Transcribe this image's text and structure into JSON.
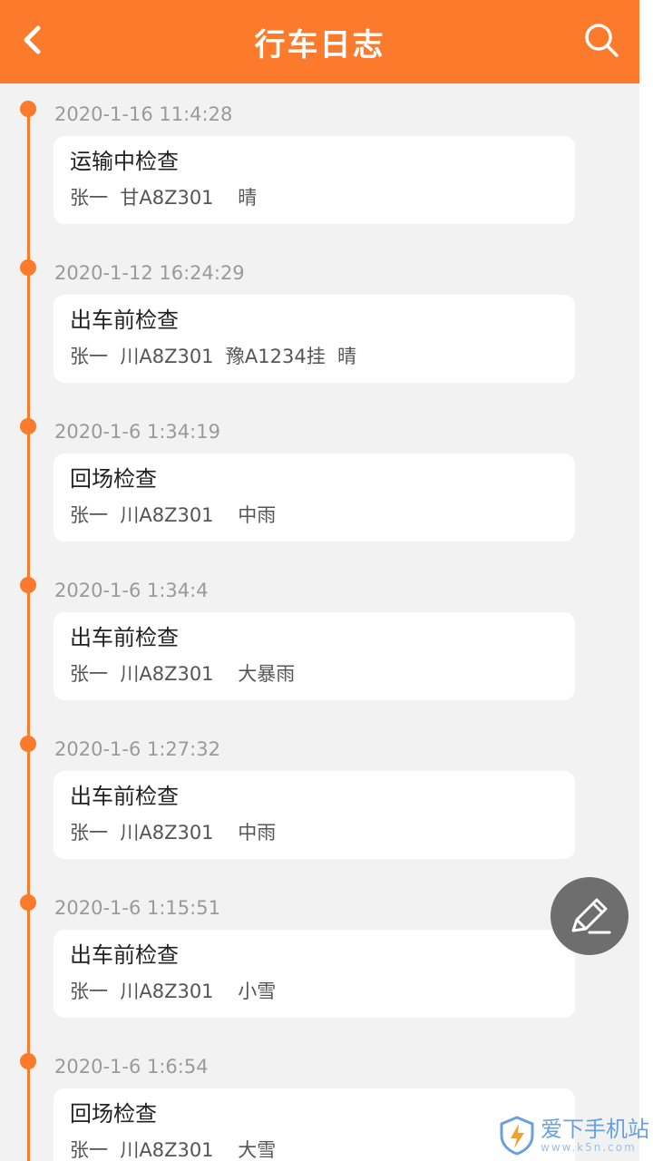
{
  "header": {
    "title": "行车日志",
    "back_icon": "chevron-left-icon",
    "search_icon": "search-icon",
    "background_color": "#fb7a2b"
  },
  "entries": [
    {
      "time": "2020-1-16 11:4:28",
      "title": "运输中检查",
      "detail": "张一  甘A8Z301    晴"
    },
    {
      "time": "2020-1-12 16:24:29",
      "title": "出车前检查",
      "detail": "张一  川A8Z301  豫A1234挂  晴"
    },
    {
      "time": "2020-1-6 1:34:19",
      "title": "回场检查",
      "detail": "张一  川A8Z301    中雨"
    },
    {
      "time": "2020-1-6 1:34:4",
      "title": "出车前检查",
      "detail": "张一  川A8Z301    大暴雨"
    },
    {
      "time": "2020-1-6 1:27:32",
      "title": "出车前检查",
      "detail": "张一  川A8Z301    中雨"
    },
    {
      "time": "2020-1-6 1:15:51",
      "title": "出车前检查",
      "detail": "张一  川A8Z301    小雪"
    },
    {
      "time": "2020-1-6 1:6:54",
      "title": "回场检查",
      "detail": "张一  川A8Z301    大雪"
    }
  ],
  "fab": {
    "icon": "pencil-icon"
  },
  "watermark": {
    "main": "爱下手机站",
    "sub": "www.k5n.com",
    "icon": "shield-bolt-icon"
  }
}
